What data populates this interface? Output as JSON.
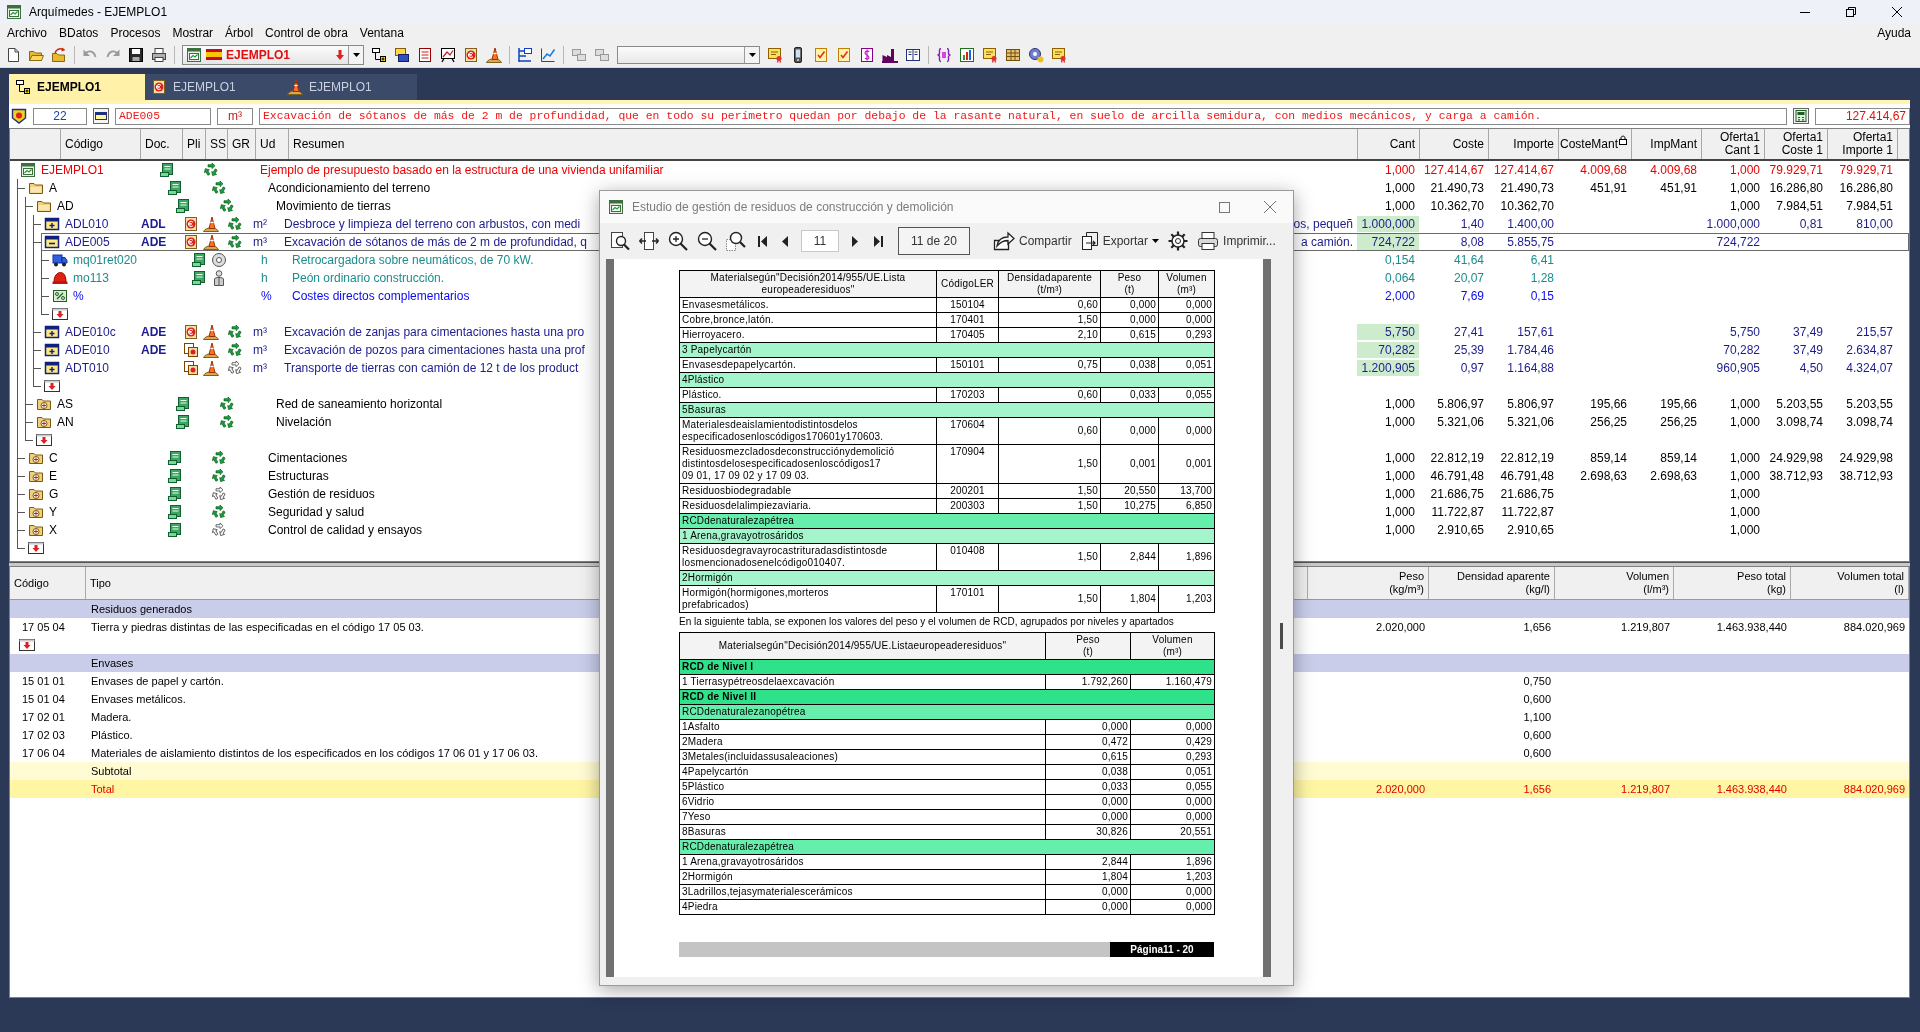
{
  "window": {
    "title": "Arquímedes - EJEMPLO1"
  },
  "menu": {
    "items": [
      "Archivo",
      "BDatos",
      "Procesos",
      "Mostrar",
      "Árbol",
      "Control de obra",
      "Ventana"
    ],
    "help": "Ayuda"
  },
  "toolbar": {
    "project": "EJEMPLO1"
  },
  "tabs": [
    {
      "label": "EJEMPLO1",
      "selected": true
    },
    {
      "label": "EJEMPLO1",
      "selected": false
    },
    {
      "label": "EJEMPLO1",
      "selected": false
    }
  ],
  "edit_bar": {
    "number": "22",
    "code": "ADE005",
    "unit": "m³",
    "description": "Excavación de sótanos de más de 2 m de profundidad, que en todo su perímetro quedan por debajo de la rasante natural, en suelo de arcilla semidura, con medios mecánicos, y carga a camión.",
    "total": "127.414,67"
  },
  "tree": {
    "columns": {
      "left": [
        "Código",
        "Doc.",
        "Pli",
        "SS",
        "GR",
        "Ud",
        "Resumen"
      ],
      "right": [
        {
          "label": "Cant",
          "locked": false
        },
        {
          "label": "Coste",
          "locked": false
        },
        {
          "label": "Importe",
          "locked": false
        },
        {
          "label": "CosteMant",
          "locked": true
        },
        {
          "label": "ImpMant",
          "locked": false
        },
        {
          "label": "Oferta1\nCant 1",
          "locked": false
        },
        {
          "label": "Oferta1\nCoste 1",
          "locked": false
        },
        {
          "label": "Oferta1\nImporte 1",
          "locked": false
        }
      ]
    },
    "nodes": [
      {
        "kind": "root",
        "code": "EJEMPLO1",
        "pli": {
          "kind": "spec"
        },
        "waste_defined": true,
        "summary": "Ejemplo de presupuesto basado en la estructura de una vivienda unifamiliar",
        "values": {
          "cant": "1,000",
          "coste": "127.414,67",
          "importe": "127.414,67",
          "coste_mant": "4.009,68",
          "imp_mant": "4.009,68",
          "oferta_cant": "1,000",
          "oferta_coste": "79.929,71",
          "oferta_importe": "79.929,71"
        },
        "selected": false,
        "children": [
          {
            "kind": "chapter",
            "code": "A",
            "expanded": true,
            "pli": {
              "kind": "spec"
            },
            "waste_defined": true,
            "summary": "Acondicionamiento del terreno",
            "values": {
              "cant": "1,000",
              "coste": "21.490,73",
              "importe": "21.490,73",
              "coste_mant": "451,91",
              "imp_mant": "451,91",
              "oferta_cant": "1,000",
              "oferta_coste": "16.286,80",
              "oferta_importe": "16.286,80"
            },
            "selected": false,
            "children": [
              {
                "kind": "chapter",
                "code": "AD",
                "expanded": true,
                "pli": {
                  "kind": "spec"
                },
                "waste_defined": true,
                "summary": "Movimiento de tierras",
                "values": {
                  "cant": "1,000",
                  "coste": "10.362,70",
                  "importe": "10.362,70",
                  "oferta_cant": "1,000",
                  "oferta_coste": "7.984,51",
                  "oferta_importe": "7.984,51"
                },
                "selected": false,
                "children": [
                  {
                    "kind": "item",
                    "code": "ADL010",
                    "doc": "ADL",
                    "expanded": false,
                    "pli": {
                      "kind": "price"
                    },
                    "ss": {
                      "kind": "cone"
                    },
                    "waste_defined": true,
                    "unit": "m²",
                    "summary": "Desbroce y limpieza del terreno con arbustos, con medi",
                    "summary_end": "os, pequeñ",
                    "measured": true,
                    "values": {
                      "cant": "1.000,000",
                      "coste": "1,40",
                      "importe": "1.400,00",
                      "oferta_cant": "1.000,000",
                      "oferta_coste": "0,81",
                      "oferta_importe": "810,00"
                    },
                    "selected": false
                  },
                  {
                    "kind": "item",
                    "code": "ADE005",
                    "doc": "ADE",
                    "expanded": true,
                    "pli": {
                      "kind": "price"
                    },
                    "ss": {
                      "kind": "cone"
                    },
                    "waste_defined": true,
                    "unit": "m³",
                    "summary": "Excavación de sótanos de más de 2 m de profundidad, q",
                    "summary_end": "a camión.",
                    "measured": true,
                    "values": {
                      "cant": "724,722",
                      "coste": "8,08",
                      "importe": "5.855,75",
                      "oferta_cant": "724,722"
                    },
                    "selected": true,
                    "children": [
                      {
                        "kind": "machinery",
                        "code": "mq01ret020",
                        "pli": {
                          "kind": "spec"
                        },
                        "ss": {
                          "kind": "machine"
                        },
                        "unit": "h",
                        "summary": "Retrocargadora sobre neumáticos, de 70 kW.",
                        "values": {
                          "cant": "0,154",
                          "coste": "41,64",
                          "importe": "6,41"
                        },
                        "selected": false
                      },
                      {
                        "kind": "labour",
                        "code": "mo113",
                        "pli": {
                          "kind": "spec"
                        },
                        "ss": {
                          "kind": "worker"
                        },
                        "unit": "h",
                        "summary": "Peón ordinario construcción.",
                        "values": {
                          "cant": "0,064",
                          "coste": "20,07",
                          "importe": "1,28"
                        },
                        "selected": false
                      },
                      {
                        "kind": "percent",
                        "code": "%",
                        "unit": "%",
                        "summary": "Costes directos complementarios",
                        "values": {
                          "cant": "2,000",
                          "coste": "7,69",
                          "importe": "0,15"
                        },
                        "selected": false
                      },
                      {
                        "kind": "new",
                        "selected": false
                      }
                    ]
                  },
                  {
                    "kind": "item",
                    "code": "ADE010c",
                    "doc": "ADE",
                    "expanded": false,
                    "pli": {
                      "kind": "price"
                    },
                    "ss": {
                      "kind": "cone"
                    },
                    "waste_defined": true,
                    "unit": "m³",
                    "summary": "Excavación de zanjas para cimentaciones hasta una pro",
                    "measured": true,
                    "values": {
                      "cant": "5,750",
                      "coste": "27,41",
                      "importe": "157,61",
                      "oferta_cant": "5,750",
                      "oferta_coste": "37,49",
                      "oferta_importe": "215,57"
                    },
                    "selected": false
                  },
                  {
                    "kind": "item",
                    "code": "ADE010",
                    "doc": "ADE",
                    "expanded": false,
                    "pli": {
                      "kind": "multi"
                    },
                    "ss": {
                      "kind": "cone"
                    },
                    "waste_defined": true,
                    "unit": "m³",
                    "summary": "Excavación de pozos para cimentaciones hasta una prof",
                    "measured": true,
                    "values": {
                      "cant": "70,282",
                      "coste": "25,39",
                      "importe": "1.784,46",
                      "oferta_cant": "70,282",
                      "oferta_coste": "37,49",
                      "oferta_importe": "2.634,87"
                    },
                    "selected": false
                  },
                  {
                    "kind": "item",
                    "code": "ADT010",
                    "expanded": false,
                    "pli": {
                      "kind": "multi"
                    },
                    "ss": {
                      "kind": "cone"
                    },
                    "waste_defined": false,
                    "unit": "m³",
                    "summary": "Transporte de tierras con camión de 12 t de los product",
                    "measured": true,
                    "values": {
                      "cant": "1.200,905",
                      "coste": "0,97",
                      "importe": "1.164,88",
                      "oferta_cant": "960,905",
                      "oferta_coste": "4,50",
                      "oferta_importe": "4.324,07"
                    },
                    "selected": false
                  },
                  {
                    "kind": "new",
                    "selected": false
                  }
                ]
              },
              {
                "kind": "chapter",
                "code": "AS",
                "expanded": false,
                "pli": {
                  "kind": "spec"
                },
                "waste_defined": true,
                "summary": "Red de saneamiento horizontal",
                "values": {
                  "cant": "1,000",
                  "coste": "5.806,97",
                  "importe": "5.806,97",
                  "coste_mant": "195,66",
                  "imp_mant": "195,66",
                  "oferta_cant": "1,000",
                  "oferta_coste": "5.203,55",
                  "oferta_importe": "5.203,55"
                },
                "selected": false
              },
              {
                "kind": "chapter",
                "code": "AN",
                "expanded": false,
                "pli": {
                  "kind": "spec"
                },
                "waste_defined": true,
                "summary": "Nivelación",
                "values": {
                  "cant": "1,000",
                  "coste": "5.321,06",
                  "importe": "5.321,06",
                  "coste_mant": "256,25",
                  "imp_mant": "256,25",
                  "oferta_cant": "1,000",
                  "oferta_coste": "3.098,74",
                  "oferta_importe": "3.098,74"
                },
                "selected": false
              },
              {
                "kind": "new",
                "selected": false
              }
            ]
          },
          {
            "kind": "chapter",
            "code": "C",
            "expanded": false,
            "pli": {
              "kind": "spec"
            },
            "waste_defined": true,
            "summary": "Cimentaciones",
            "values": {
              "cant": "1,000",
              "coste": "22.812,19",
              "importe": "22.812,19",
              "coste_mant": "859,14",
              "imp_mant": "859,14",
              "oferta_cant": "1,000",
              "oferta_coste": "24.929,98",
              "oferta_importe": "24.929,98"
            },
            "selected": false
          },
          {
            "kind": "chapter",
            "code": "E",
            "expanded": false,
            "pli": {
              "kind": "spec"
            },
            "waste_defined": true,
            "summary": "Estructuras",
            "values": {
              "cant": "1,000",
              "coste": "46.791,48",
              "importe": "46.791,48",
              "coste_mant": "2.698,63",
              "imp_mant": "2.698,63",
              "oferta_cant": "1,000",
              "oferta_coste": "38.712,93",
              "oferta_importe": "38.712,93"
            },
            "selected": false
          },
          {
            "kind": "chapter",
            "code": "G",
            "expanded": false,
            "pli": {
              "kind": "spec"
            },
            "waste_defined": false,
            "summary": "Gestión de residuos",
            "values": {
              "cant": "1,000",
              "coste": "21.686,75",
              "importe": "21.686,75",
              "oferta_cant": "1,000"
            },
            "selected": false
          },
          {
            "kind": "chapter",
            "code": "Y",
            "expanded": false,
            "pli": {
              "kind": "spec"
            },
            "waste_defined": true,
            "summary": "Seguridad y salud",
            "values": {
              "cant": "1,000",
              "coste": "11.722,87",
              "importe": "11.722,87",
              "oferta_cant": "1,000"
            },
            "selected": false
          },
          {
            "kind": "chapter",
            "code": "X",
            "expanded": false,
            "pli": {
              "kind": "spec"
            },
            "waste_defined": false,
            "summary": "Control de calidad y ensayos",
            "values": {
              "cant": "1,000",
              "coste": "2.910,65",
              "importe": "2.910,65",
              "oferta_cant": "1,000"
            },
            "selected": false
          },
          {
            "kind": "new",
            "selected": false
          }
        ]
      }
    ]
  },
  "waste_table": {
    "columns": [
      "Código",
      "Tipo",
      "Peso\n(kg/m³)",
      "Densidad aparente\n(kg/l)",
      "Volumen\n(l/m³)",
      "Peso total\n(kg)",
      "Volumen total\n(l)"
    ],
    "rows": [
      {
        "kind": "group",
        "type": "Residuos generados"
      },
      {
        "kind": "waste",
        "code": "17 05 04",
        "type": "Tierra y piedras distintas de las especificadas en el código 17 05 03.",
        "values": {
          "peso": "2.020,000",
          "densidad": "1,656",
          "volumen": "1.219,807",
          "peso_total": "1.463.938,440",
          "volumen_total": "884.020,969"
        }
      },
      {
        "kind": "new"
      },
      {
        "kind": "group",
        "type": "Envases"
      },
      {
        "kind": "waste",
        "code": "15 01 01",
        "type": "Envases de papel y cartón.",
        "values": {
          "densidad": "0,750"
        }
      },
      {
        "kind": "waste",
        "code": "15 01 04",
        "type": "Envases metálicos.",
        "values": {
          "densidad": "0,600"
        }
      },
      {
        "kind": "waste",
        "code": "17 02 01",
        "type": "Madera.",
        "values": {
          "densidad": "1,100"
        }
      },
      {
        "kind": "waste",
        "code": "17 02 03",
        "type": "Plástico.",
        "values": {
          "densidad": "0,600"
        }
      },
      {
        "kind": "waste",
        "code": "17 06 04",
        "type": "Materiales de aislamiento distintos de los especificados en los códigos 17 06 01 y 17 06 03.",
        "values": {
          "densidad": "0,600"
        }
      },
      {
        "kind": "subtotal",
        "type": "Subtotal"
      },
      {
        "kind": "total",
        "type": "Total",
        "values": {
          "peso": "2.020,000",
          "densidad": "1,656",
          "volumen": "1.219,807",
          "peso_total": "1.463.938,440",
          "volumen_total": "884.020,969"
        }
      }
    ]
  },
  "report_window": {
    "title": "Estudio de gestión de residuos de construcción y demolición",
    "page": "11",
    "page_info": "11 de 20",
    "actions": [
      {
        "kind": "share",
        "label": "Compartir"
      },
      {
        "kind": "export",
        "label": "Exportar"
      },
      {
        "kind": "print",
        "label": "Imprimir..."
      }
    ],
    "materials_table": {
      "columns": [
        "Materialsegún\"Decisión2014/955/UE.Lista\neuropeaderesiduos\"",
        "CódigoLER",
        "Densidadaparente\n(t/m³)",
        "Peso\n(t)",
        "Volumen\n(m³)"
      ],
      "rows": [
        {
          "kind": "item",
          "material": "Envasesmetálicos.",
          "ler": "150104",
          "density": "0,60",
          "weight": "0,000",
          "volume": "0,000"
        },
        {
          "kind": "item",
          "material": "Cobre,bronce,latón.",
          "ler": "170401",
          "density": "1,50",
          "weight": "0,000",
          "volume": "0,000"
        },
        {
          "kind": "item",
          "material": "Hierroyacero.",
          "ler": "170405",
          "density": "2,10",
          "weight": "0,615",
          "volume": "0,293"
        },
        {
          "kind": "group",
          "label": "3 Papelycartón"
        },
        {
          "kind": "item",
          "material": "Envasesdepapelycartón.",
          "ler": "150101",
          "density": "0,75",
          "weight": "0,038",
          "volume": "0,051"
        },
        {
          "kind": "group",
          "label": "4Plástico"
        },
        {
          "kind": "item",
          "material": "Plástico.",
          "ler": "170203",
          "density": "0,60",
          "weight": "0,033",
          "volume": "0,055"
        },
        {
          "kind": "group",
          "label": "5Basuras"
        },
        {
          "kind": "item",
          "material": "Materialesdeaislamientodistintosdelos\nespecificadosenloscódigos170601y170603.",
          "ler": "170604",
          "density": "0,60",
          "weight": "0,000",
          "volume": "0,000"
        },
        {
          "kind": "item",
          "material": "Residuosmezcladosdeconstrucciónydemolició\ndistintosdelosespecificadosenloscódigos17\n09 01, 17 09 02 y 17 09 03.",
          "ler": "170904",
          "density": "1,50",
          "weight": "0,001",
          "volume": "0,001"
        },
        {
          "kind": "item",
          "material": "Residuosbiodegradable",
          "ler": "200201",
          "density": "1,50",
          "weight": "20,550",
          "volume": "13,700"
        },
        {
          "kind": "item",
          "material": "Residuosdelalimpiezaviaria.",
          "ler": "200303",
          "density": "1,50",
          "weight": "10,275",
          "volume": "6,850"
        },
        {
          "kind": "section",
          "label": "RCDdenaturalezapétrea"
        },
        {
          "kind": "group",
          "label": "1 Arena,gravayotrosáridos"
        },
        {
          "kind": "item",
          "material": "Residuosdegravayrocastrituradasdistintosde\nlosmencionadosenelcódigo010407.",
          "ler": "010408",
          "density": "1,50",
          "weight": "2,844",
          "volume": "1,896"
        },
        {
          "kind": "group",
          "label": "2Hormigón"
        },
        {
          "kind": "item",
          "material": "Hormigón(hormigones,morteros\nprefabricados)",
          "ler": "170101",
          "density": "1,50",
          "weight": "1,804",
          "volume": "1,203"
        }
      ]
    },
    "note": "En la siguiente tabla, se exponen los valores del peso y el volumen de RCD, agrupados por niveles y apartados",
    "levels_table": {
      "columns": [
        "Materialsegún\"Decisión2014/955/UE.Listaeuropeaderesiduos\"",
        "Peso\n(t)",
        "Volumen\n(m³)"
      ],
      "rows": [
        {
          "kind": "level",
          "label": "RCD de Nivel I"
        },
        {
          "kind": "item",
          "material": "1 Tierrasypétreosdelaexcavación",
          "weight": "1.792,260",
          "volume": "1.160,479"
        },
        {
          "kind": "level",
          "label": "RCD de Nivel II"
        },
        {
          "kind": "section",
          "label": "RCDdenaturalezanopétrea"
        },
        {
          "kind": "item",
          "material": "1Asfalto",
          "weight": "0,000",
          "volume": "0,000"
        },
        {
          "kind": "item",
          "material": "2Madera",
          "weight": "0,472",
          "volume": "0,429"
        },
        {
          "kind": "item",
          "material": "3Metales(incluidassusaleaciones)",
          "weight": "0,615",
          "volume": "0,293"
        },
        {
          "kind": "item",
          "material": "4Papelycartón",
          "weight": "0,038",
          "volume": "0,051"
        },
        {
          "kind": "item",
          "material": "5Plástico",
          "weight": "0,033",
          "volume": "0,055"
        },
        {
          "kind": "item",
          "material": "6Vidrio",
          "weight": "0,000",
          "volume": "0,000"
        },
        {
          "kind": "item",
          "material": "7Yeso",
          "weight": "0,000",
          "volume": "0,000"
        },
        {
          "kind": "item",
          "material": "8Basuras",
          "weight": "30,826",
          "volume": "20,551"
        },
        {
          "kind": "section",
          "label": "RCDdenaturalezapétrea"
        },
        {
          "kind": "item",
          "material": "1 Arena,gravayotrosáridos",
          "weight": "2,844",
          "volume": "1,896"
        },
        {
          "kind": "item",
          "material": "2Hormigón",
          "weight": "1,804",
          "volume": "1,203"
        },
        {
          "kind": "item",
          "material": "3Ladrillos,tejasymaterialescerámicos",
          "weight": "0,000",
          "volume": "0,000"
        },
        {
          "kind": "item",
          "material": "4Piedra",
          "weight": "0,000",
          "volume": "0,000"
        }
      ]
    },
    "footer": "Página11 - 20"
  }
}
